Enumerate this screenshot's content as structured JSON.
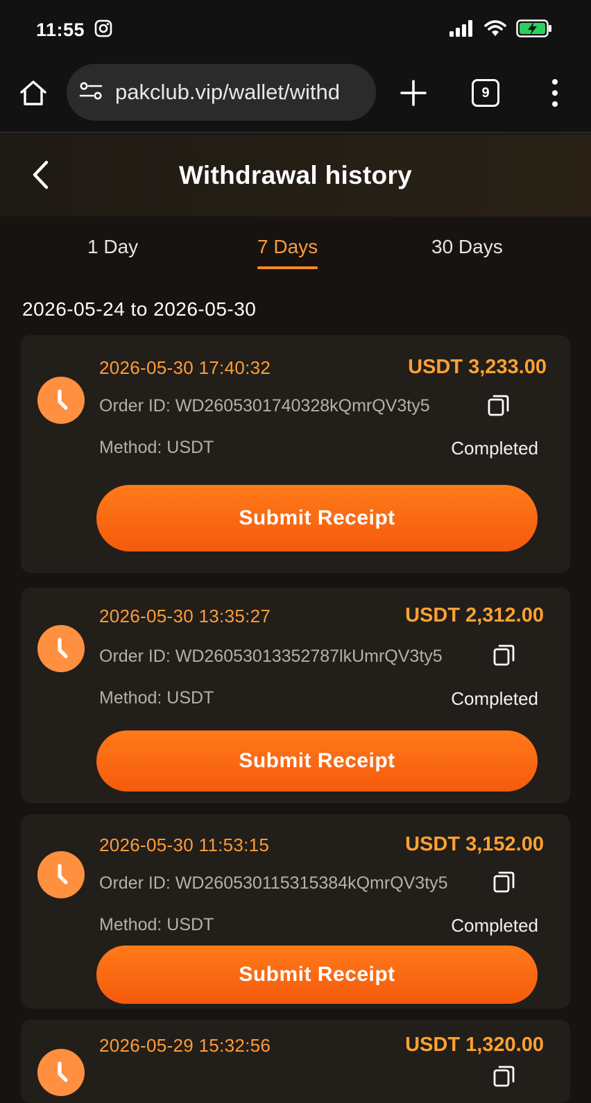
{
  "status_bar": {
    "time": "11:55"
  },
  "browser": {
    "url": "pakclub.vip/wallet/withd",
    "tab_count": "9"
  },
  "header": {
    "title": "Withdrawal history"
  },
  "period_tabs": [
    {
      "label": "1 Day"
    },
    {
      "label": "7 Days",
      "active": true
    },
    {
      "label": "30 Days"
    }
  ],
  "date_range": "2026-05-24 to 2026-05-30",
  "records": [
    {
      "datetime": "2026-05-30 17:40:32",
      "amount": "USDT 3,233.00",
      "order_id": "Order ID: WD2605301740328kQmrQV3ty5",
      "method": "Method: USDT",
      "status": "Completed",
      "button_label": "Submit Receipt"
    },
    {
      "datetime": "2026-05-30 13:35:27",
      "amount": "USDT 2,312.00",
      "order_id": "Order ID: WD26053013352787lkUmrQV3ty5",
      "method": "Method: USDT",
      "status": "Completed",
      "button_label": "Submit Receipt"
    },
    {
      "datetime": "2026-05-30 11:53:15",
      "amount": "USDT 3,152.00",
      "order_id": "Order ID: WD260530115315384kQmrQV3ty5",
      "method": "Method: USDT",
      "status": "Completed",
      "button_label": "Submit Receipt"
    },
    {
      "datetime": "2026-05-29 15:32:56",
      "amount": "USDT 1,320.00"
    }
  ],
  "colors": {
    "accent": "#ff8a1e",
    "amount": "#ffa132",
    "card_bg": "#221e19",
    "page_bg": "#161311"
  }
}
